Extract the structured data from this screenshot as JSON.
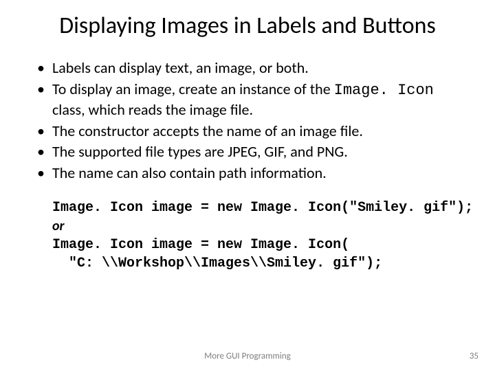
{
  "title": "Displaying Images in Labels and Buttons",
  "bullets": [
    {
      "pre": "Labels can display text, an image, or both."
    },
    {
      "pre": "To display an image, create an instance of the ",
      "code": "Image. Icon",
      "post": " class, which reads the image file."
    },
    {
      "pre": "The constructor accepts the name of an image file."
    },
    {
      "pre": "The supported file types are JPEG, GIF, and PNG."
    },
    {
      "pre": "The name can also contain path information."
    }
  ],
  "code": {
    "l1": "Image. Icon image = new Image. Icon(\"Smiley. gif\");",
    "or": "or",
    "l2": "Image. Icon image = new Image. Icon(",
    "l3": "  \"C: \\\\Workshop\\\\Images\\\\Smiley. gif\");"
  },
  "footer": {
    "center": "More GUI Programming",
    "page": "35"
  }
}
